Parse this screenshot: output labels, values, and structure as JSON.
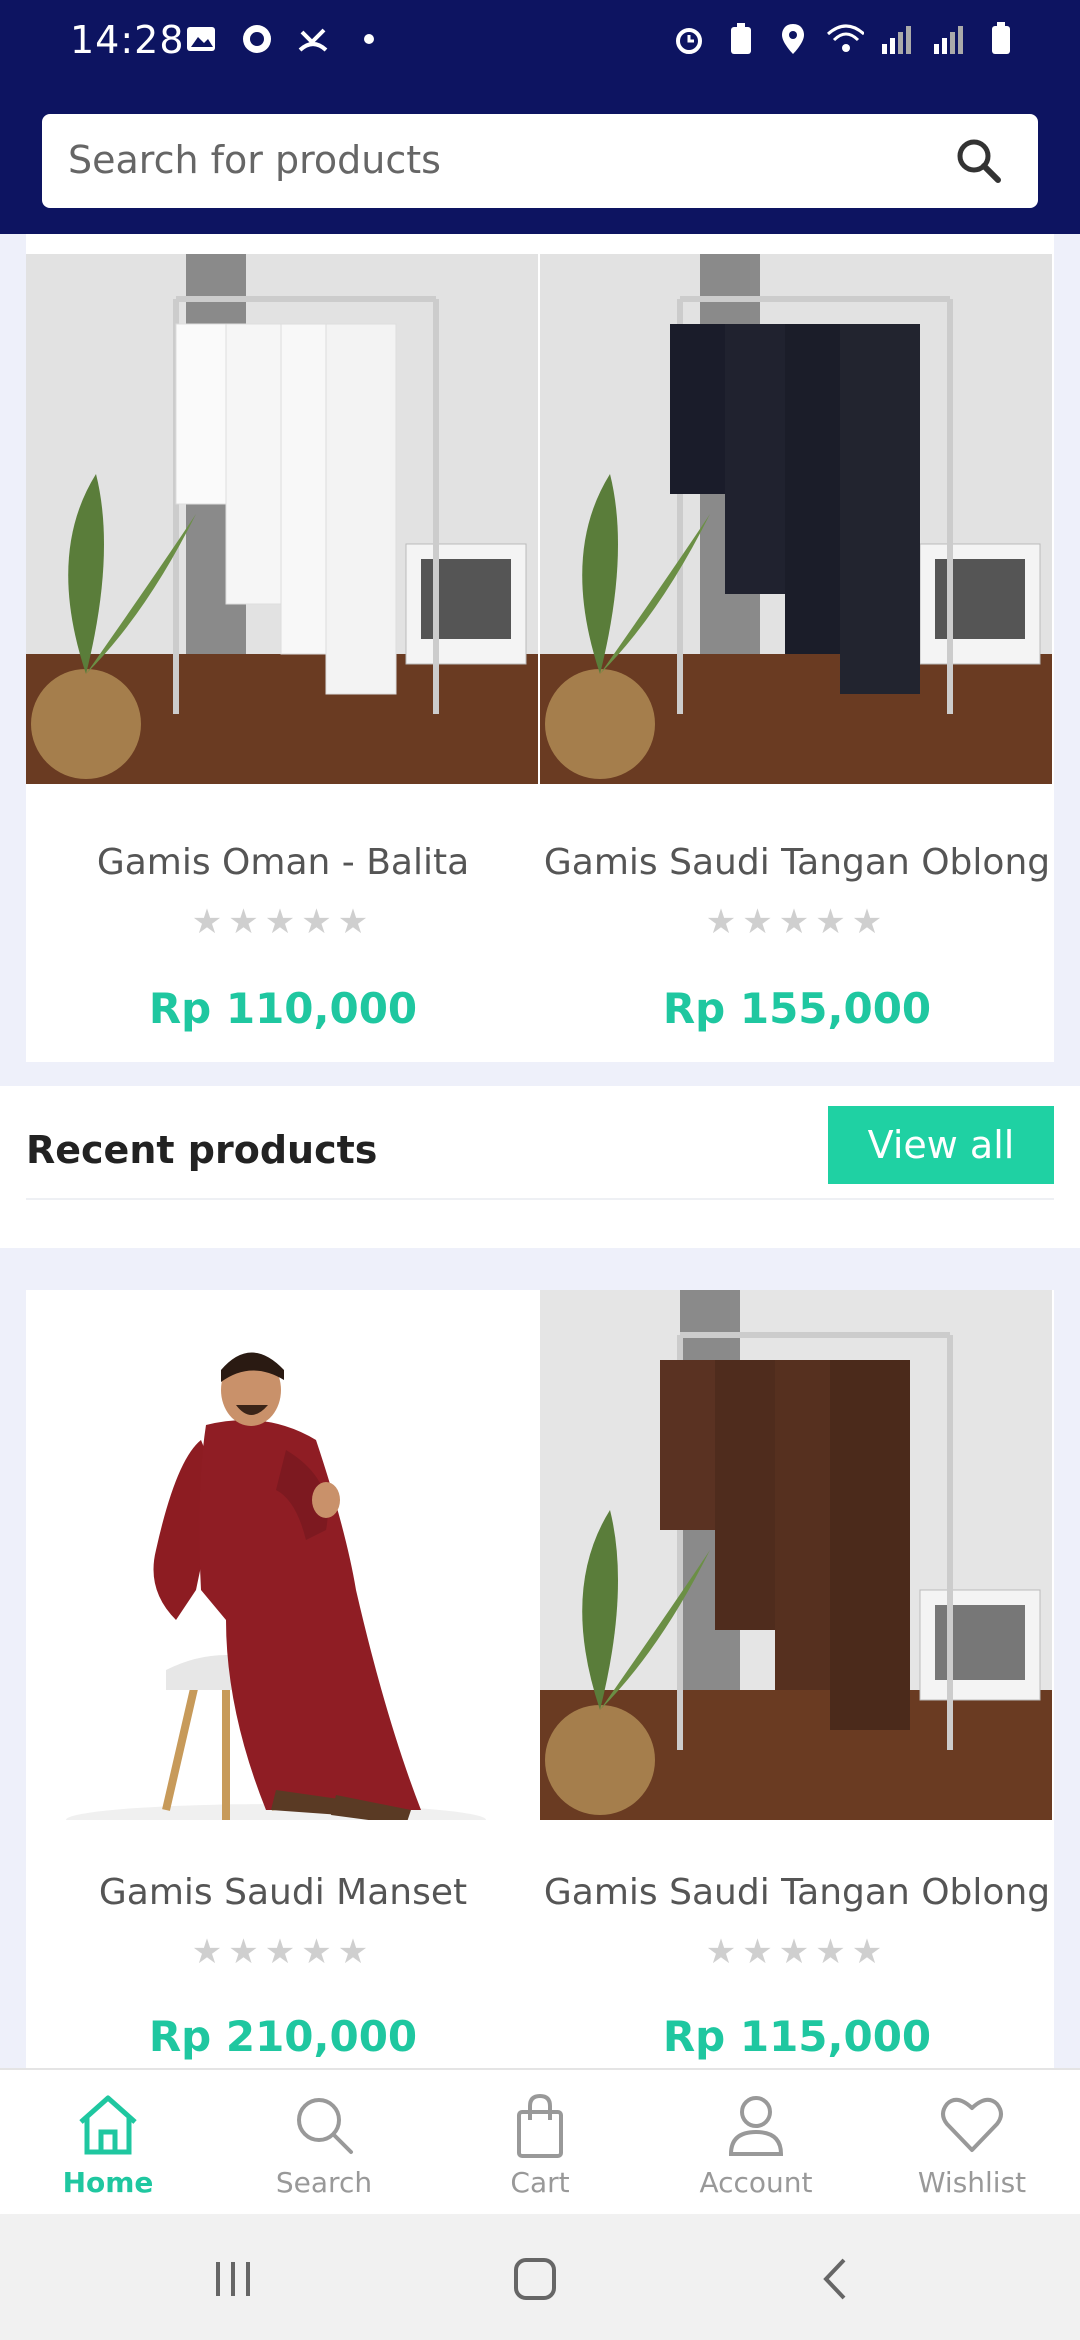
{
  "status": {
    "time": "14:28"
  },
  "search": {
    "placeholder": "Search for products"
  },
  "featured": [
    {
      "name": "Gamis Oman - Balita",
      "rating": 0,
      "price": "Rp 110,000"
    },
    {
      "name": "Gamis Saudi Tangan Oblong",
      "rating": 0,
      "price": "Rp 155,000"
    }
  ],
  "section": {
    "title": "Recent products",
    "button": "View all"
  },
  "recent": [
    {
      "name": "Gamis Saudi Manset",
      "rating": 0,
      "price": "Rp 210,000"
    },
    {
      "name": "Gamis Saudi Tangan Oblong",
      "rating": 0,
      "price": "Rp 115,000"
    }
  ],
  "nav": [
    {
      "label": "Home",
      "icon": "home-icon",
      "active": true
    },
    {
      "label": "Search",
      "icon": "search-icon",
      "active": false
    },
    {
      "label": "Cart",
      "icon": "bag-icon",
      "active": false
    },
    {
      "label": "Account",
      "icon": "user-icon",
      "active": false
    },
    {
      "label": "Wishlist",
      "icon": "heart-icon",
      "active": false
    }
  ],
  "stars": "★★★★★",
  "colors": {
    "accent": "#1fc7a0",
    "header": "#0d1461",
    "button": "#1fd1a3"
  }
}
